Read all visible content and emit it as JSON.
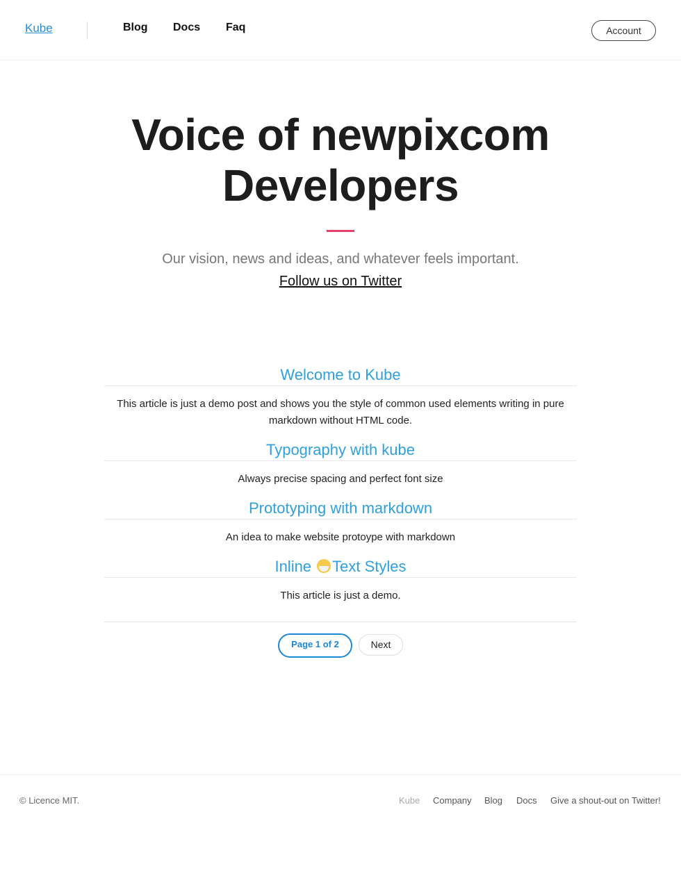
{
  "header": {
    "brand": "Kube",
    "nav": [
      {
        "label": "Blog"
      },
      {
        "label": "Docs"
      },
      {
        "label": "Faq"
      }
    ],
    "account_label": "Account"
  },
  "hero": {
    "title_line1": "Voice of newpixcom",
    "title_line2": "Developers",
    "subtitle": "Our vision, news and ideas, and whatever feels important.",
    "link": "Follow us on Twitter"
  },
  "posts": [
    {
      "title": "Welcome to Kube",
      "desc_line1": "This article is just a demo post and shows you the style of common used elements writing in pure",
      "desc_line2": "markdown without HTML code."
    },
    {
      "title": "Typography with kube",
      "desc": "Always precise spacing and perfect font size"
    },
    {
      "title": "Prototyping with markdown",
      "desc": "An idea to make website protoype with markdown"
    },
    {
      "title_before": "Inline",
      "title_after": "Text Styles",
      "emoji": "hatching-chick-emoji",
      "desc": "This article is just a demo."
    }
  ],
  "pagination": {
    "indicator": "Page 1 of 2",
    "next": "Next"
  },
  "footer": {
    "copyright": "© Licence MIT.",
    "links": [
      {
        "label": "Kube"
      },
      {
        "label": "Company"
      },
      {
        "label": "Blog"
      },
      {
        "label": "Docs"
      },
      {
        "label": "Give a shout-out on Twitter!"
      }
    ]
  },
  "colors": {
    "accent_link": "#2fa0dc",
    "rule": "#e83e6c",
    "primary_button": "#1c86d8"
  }
}
